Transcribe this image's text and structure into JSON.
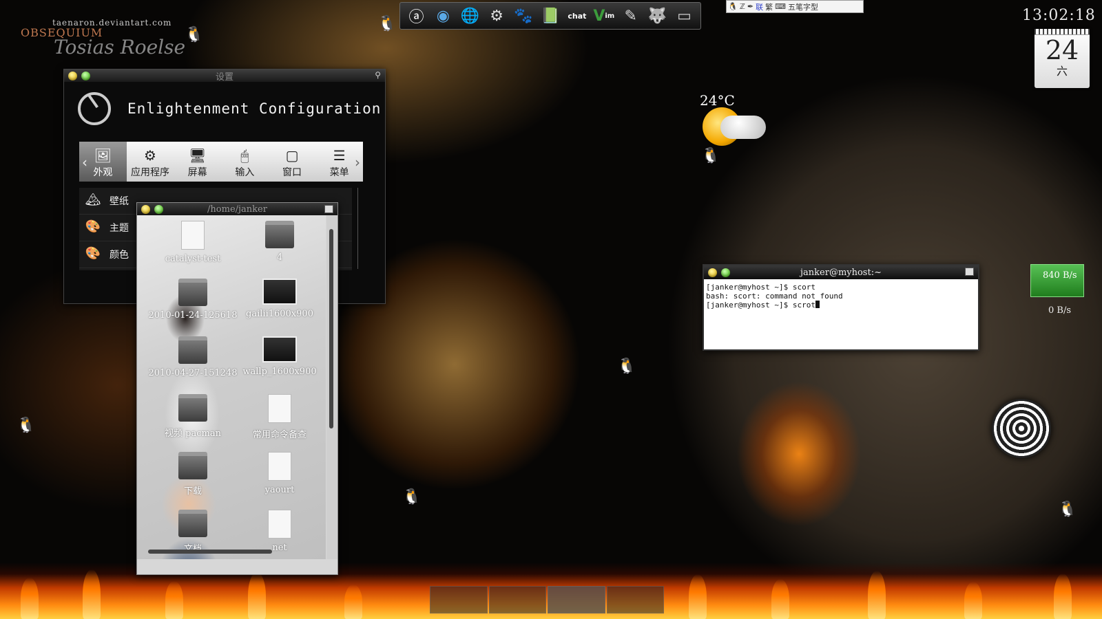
{
  "branding": {
    "site": "taenaron.deviantart.com",
    "name": "OBSEQUIUM",
    "signature": "Tosias Roelse"
  },
  "dock": {
    "items": [
      {
        "icon": "launcher-a-icon",
        "glyph": "ⓐ"
      },
      {
        "icon": "chromium-icon",
        "glyph": "◉"
      },
      {
        "icon": "firefox-icon",
        "glyph": "🌐"
      },
      {
        "icon": "settings-tools-icon",
        "glyph": "⚙"
      },
      {
        "icon": "gnome-foot-icon",
        "glyph": "🐾"
      },
      {
        "icon": "book-icon",
        "glyph": "📗"
      },
      {
        "icon": "xchat-icon",
        "glyph": "✖"
      },
      {
        "icon": "vim-icon",
        "glyph": "V"
      },
      {
        "icon": "editor-icon",
        "glyph": "✎"
      },
      {
        "icon": "gimp-icon",
        "glyph": "🐺"
      },
      {
        "icon": "terminal-icon",
        "glyph": "▭"
      }
    ],
    "chat_label": "chat",
    "vim_label": "im"
  },
  "tray": {
    "input_method": "五笔字型",
    "items": [
      "联",
      "繁"
    ]
  },
  "clock": {
    "time": "13:02:18",
    "day": "24",
    "weekday": "六"
  },
  "weather": {
    "temperature": "24°C"
  },
  "netmeter": {
    "up": "840 B/s",
    "down": "0 B/s"
  },
  "config_window": {
    "title": "设置",
    "heading": "Enlightenment Configuration",
    "categories": [
      {
        "label": "外观",
        "icon": "appearance-icon",
        "glyph": "🖼",
        "selected": true
      },
      {
        "label": "应用程序",
        "icon": "applications-gear-icon",
        "glyph": "⚙"
      },
      {
        "label": "屏幕",
        "icon": "screen-icon",
        "glyph": "🖥"
      },
      {
        "label": "输入",
        "icon": "input-mouse-icon",
        "glyph": "🖱"
      },
      {
        "label": "窗口",
        "icon": "window-icon",
        "glyph": "▢"
      },
      {
        "label": "菜单",
        "icon": "menu-icon",
        "glyph": "☰"
      }
    ],
    "items": [
      {
        "label": "壁纸",
        "icon": "wallpaper-icon",
        "glyph": "🏔"
      },
      {
        "label": "主题",
        "icon": "theme-icon",
        "glyph": "🎨"
      },
      {
        "label": "颜色",
        "icon": "color-palette-icon",
        "glyph": "🎨"
      }
    ]
  },
  "file_manager": {
    "title": "/home/janker",
    "items": [
      {
        "label": "catalyst-test",
        "type": "file"
      },
      {
        "label": "4",
        "type": "folder"
      },
      {
        "label": "2010-01-24-125618",
        "type": "folder"
      },
      {
        "label": "gailii1600x900",
        "type": "thumb"
      },
      {
        "label": "2010-04-27-151248",
        "type": "folder"
      },
      {
        "label": "wallp_1600x900",
        "type": "thumb"
      },
      {
        "label": "视频 pacman",
        "type": "folder"
      },
      {
        "label": "常用命令备查",
        "type": "file"
      },
      {
        "label": "下载",
        "type": "folder"
      },
      {
        "label": "yaourt",
        "type": "file"
      },
      {
        "label": "文档",
        "type": "folder"
      },
      {
        "label": "net",
        "type": "file"
      }
    ]
  },
  "terminal": {
    "title": "janker@myhost:~",
    "lines": [
      "[janker@myhost ~]$ scort",
      "bash: scort: command not found",
      "[janker@myhost ~]$ scrot"
    ]
  }
}
